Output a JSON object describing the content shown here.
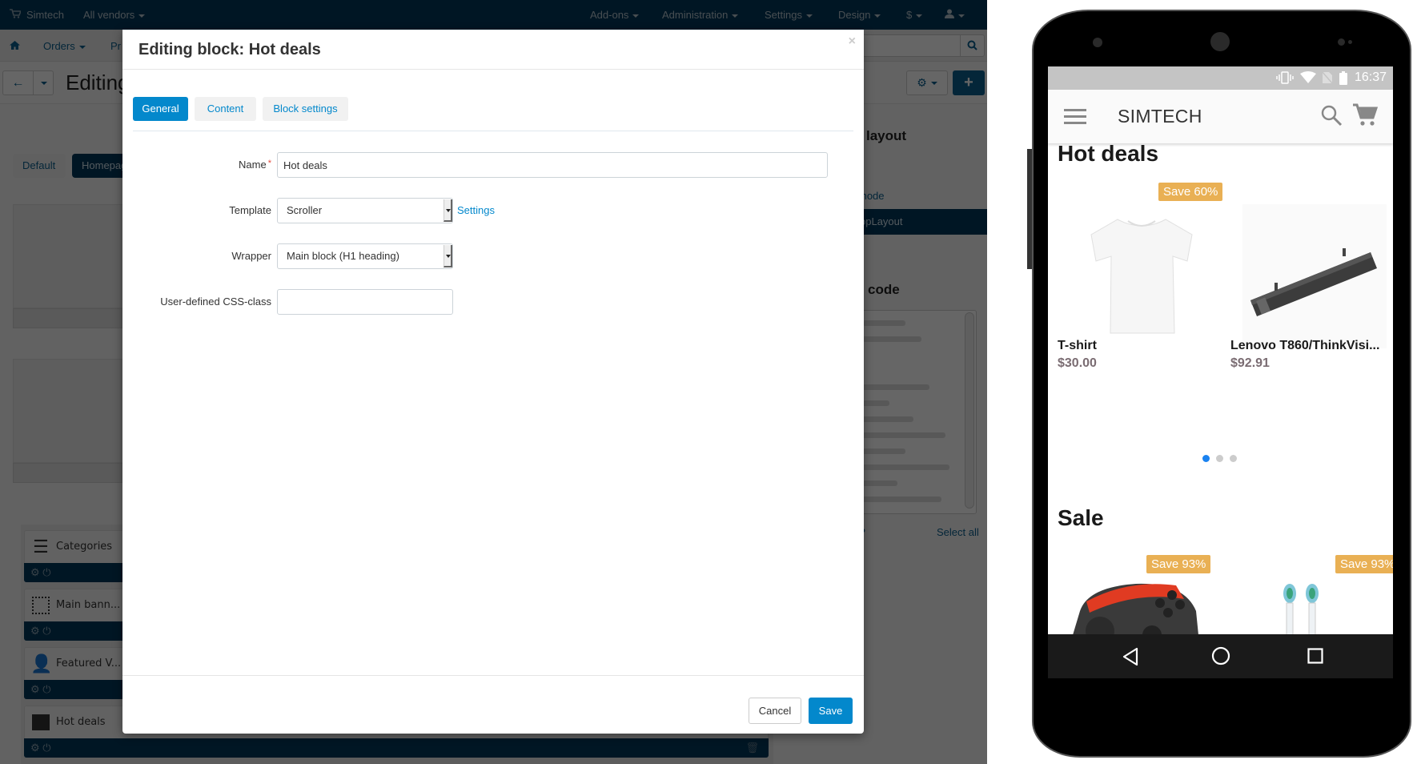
{
  "admin": {
    "topnav": {
      "store_name": "Simtech",
      "vendors": "All vendors",
      "menu": [
        "Add-ons",
        "Administration",
        "Settings",
        "Design",
        "$"
      ],
      "user_icon": "user-icon"
    },
    "subnav": {
      "home_icon": "home-icon",
      "items": [
        "Orders",
        "Pr"
      ]
    },
    "page_title": "Editing",
    "layout_tabs": [
      "Default",
      "Homepage"
    ],
    "blocks": [
      {
        "label": "Categories",
        "icon": "list-icon"
      },
      {
        "label": "Main bann...",
        "icon": "dotted-square-icon"
      },
      {
        "label": "Featured V...",
        "icon": "vendor-icon"
      },
      {
        "label": "Hot deals",
        "icon": "box-icon"
      }
    ],
    "right_panel": {
      "layout_title": "layout",
      "mode_link": "mode",
      "selected_layout": "opLayout",
      "code_title": "code",
      "question_link": "t?",
      "select_all": "Select all"
    }
  },
  "dialog": {
    "title": "Editing block: Hot deals",
    "close_symbol": "×",
    "tabs": [
      {
        "label": "General",
        "active": true
      },
      {
        "label": "Content",
        "active": false
      },
      {
        "label": "Block settings",
        "active": false
      }
    ],
    "fields": {
      "name": {
        "label": "Name",
        "required_mark": "*",
        "value": "Hot deals"
      },
      "template": {
        "label": "Template",
        "value": "Scroller",
        "settings_link": "Settings"
      },
      "wrapper": {
        "label": "Wrapper",
        "value": "Main block (H1 heading)"
      },
      "css_class": {
        "label": "User-defined CSS-class",
        "value": ""
      }
    },
    "buttons": {
      "cancel": "Cancel",
      "save": "Save"
    }
  },
  "phone": {
    "status_time": "16:37",
    "brand": "SIMTECH",
    "sections": [
      {
        "title": "Hot deals",
        "products": [
          {
            "name": "T-shirt",
            "price": "$30.00",
            "badge": "Save 60%"
          },
          {
            "name": "Lenovo T860/ThinkVisi...",
            "price": "$92.91",
            "badge": ""
          }
        ],
        "carousel_pages": 3,
        "carousel_active": 1
      },
      {
        "title": "Sale",
        "products": [
          {
            "name": "",
            "price": "",
            "badge": "Save 93%"
          },
          {
            "name": "",
            "price": "",
            "badge": "Save 93%"
          }
        ]
      }
    ]
  }
}
